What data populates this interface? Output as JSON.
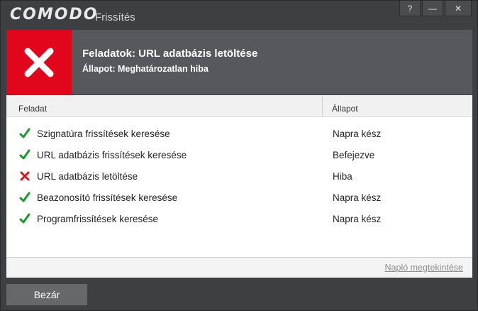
{
  "window": {
    "brand": "COMODO",
    "title": "Frissítés",
    "buttons": {
      "help": "?",
      "minimize": "—",
      "close": "✕"
    }
  },
  "header": {
    "title": "Feladatok: URL adatbázis letöltése",
    "status": "Állapot: Meghatározatlan hiba",
    "error_color": "#e1061b"
  },
  "table": {
    "columns": [
      "Feladat",
      "Állapot"
    ],
    "rows": [
      {
        "task": "Szignatúra frissítések keresése",
        "status": "Napra kész",
        "icon": "check-icon"
      },
      {
        "task": "URL adatbázis frissítések keresése",
        "status": "Befejezve",
        "icon": "check-icon"
      },
      {
        "task": "URL adatbázis letöltése",
        "status": "Hiba",
        "icon": "error-icon"
      },
      {
        "task": "Beazonosító frissítések keresése",
        "status": "Napra kész",
        "icon": "check-icon"
      },
      {
        "task": "Programfrissítések keresése",
        "status": "Napra kész",
        "icon": "check-icon"
      }
    ]
  },
  "footer": {
    "log_link": "Napló megtekintése"
  },
  "actions": {
    "close_label": "Bezár"
  },
  "colors": {
    "check": "#1a9a2a",
    "error": "#d8141f",
    "background": "#3d3f43"
  }
}
